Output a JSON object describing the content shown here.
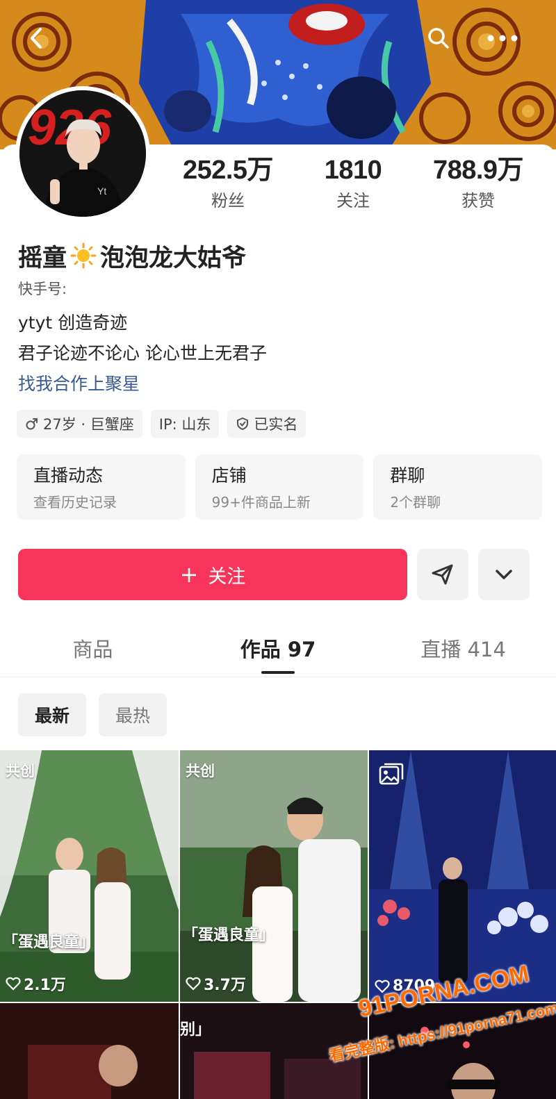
{
  "header": {
    "back_icon": "back-arrow-icon",
    "search_icon": "search-icon",
    "more_icon": "more-dots-icon"
  },
  "avatar": {
    "text": "926",
    "shirt_text": "Yt"
  },
  "stats": [
    {
      "value": "252.5万",
      "label": "粉丝"
    },
    {
      "value": "1810",
      "label": "关注"
    },
    {
      "value": "788.9万",
      "label": "获赞"
    }
  ],
  "profile": {
    "name_part1": "摇童",
    "name_part2": "泡泡龙大姑爷",
    "kuaishou_id_label": "快手号:",
    "kuaishou_id_value": "",
    "bio_line1": "ytyt   创造奇迹",
    "bio_line2": "君子论迹不论心  论心世上无君子",
    "collab_link": "找我合作上聚星"
  },
  "tags": [
    {
      "icon": "male-icon",
      "text": "27岁 · 巨蟹座"
    },
    {
      "icon": "",
      "text": "IP: 山东"
    },
    {
      "icon": "verified-shield-icon",
      "text": "已实名"
    }
  ],
  "cards": [
    {
      "title": "直播动态",
      "sub": "查看历史记录"
    },
    {
      "title": "店铺",
      "sub": "99+件商品上新"
    },
    {
      "title": "群聊",
      "sub": "2个群聊"
    }
  ],
  "actions": {
    "follow_label": "关注",
    "follow_plus": "+",
    "share_icon": "send-icon",
    "dropdown_icon": "chevron-down-icon"
  },
  "colors": {
    "follow": "#f7345a",
    "link": "#3a5a92"
  },
  "tabs": [
    {
      "label": "商品",
      "count": "",
      "active": false
    },
    {
      "label": "作品",
      "count": "97",
      "active": true
    },
    {
      "label": "直播",
      "count": "414",
      "active": false
    }
  ],
  "sort": [
    {
      "label": "最新",
      "active": true
    },
    {
      "label": "最热",
      "active": false
    }
  ],
  "videos": [
    {
      "label": "共创",
      "caption": "「蛋遇良童」",
      "likes": "2.1万"
    },
    {
      "label": "共创",
      "caption": "「蛋遇良童」",
      "likes": "3.7万"
    },
    {
      "label": "",
      "caption": "",
      "likes": "8709"
    },
    {
      "label": "",
      "caption": "",
      "likes": ""
    },
    {
      "label": "",
      "caption": "别」",
      "likes": ""
    },
    {
      "label": "",
      "caption": "",
      "likes": ""
    }
  ],
  "watermark": {
    "brand": "91PORNA.COM",
    "url": "看完整版: https://91porna71.com"
  }
}
